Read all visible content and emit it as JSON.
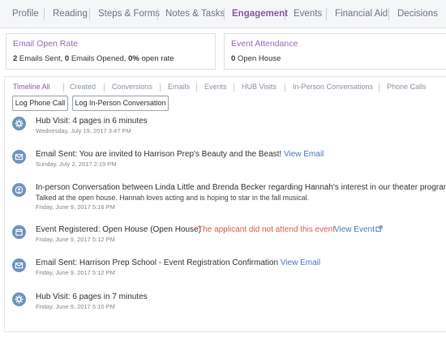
{
  "tabs": [
    {
      "label": "Profile"
    },
    {
      "label": "Reading"
    },
    {
      "label": "Steps & Forms"
    },
    {
      "label": "Notes & Tasks"
    },
    {
      "label": "Engagement"
    },
    {
      "label": "Events"
    },
    {
      "label": "Financial Aid"
    },
    {
      "label": "Decisions"
    }
  ],
  "active_tab": "Engagement",
  "email_card": {
    "title": "Email Open Rate",
    "sent_count": "2",
    "sent_label": " Emails Sent, ",
    "opened_count": "0",
    "opened_label": " Emails Opened, ",
    "rate": "0%",
    "rate_label": " open rate"
  },
  "event_card": {
    "title": "Event Attendance",
    "count": "0",
    "label": " Open House"
  },
  "filters": [
    "Timeline All",
    "Created",
    "Conversions",
    "Emails",
    "Events",
    "HUB Visits",
    "In-Person Conversations",
    "Phone Calls"
  ],
  "buttons": {
    "log_phone": "Log Phone Call",
    "log_inperson": "Log In-Person Conversation"
  },
  "timeline": [
    {
      "icon": "gear-icon",
      "text": "Hub Visit: 4 pages in 6 minutes",
      "date": "Wednesday, July 19, 2017 3:47 PM"
    },
    {
      "icon": "envelope-icon",
      "text": "Email Sent: You are invited to Harrison Prep's Beauty and the Beast!",
      "link": "View Email",
      "date": "Sunday, July 2, 2017 2:19 PM"
    },
    {
      "icon": "person-icon",
      "text": "In-person Conversation between Linda Little and Brenda Becker regarding Hannah's interest in our theater program",
      "note": "Talked at the open house. Hannah loves acting and is hoping to star in the fall musical.",
      "date": "Friday, June 9, 2017 5:16 PM"
    },
    {
      "icon": "calendar-icon",
      "text": "Event Registered: Open House (Open House)",
      "warning": "The applicant did not attend this event",
      "link": "View Event",
      "date": "Friday, June 9, 2017 5:12 PM"
    },
    {
      "icon": "envelope-icon",
      "text": "Email Sent: Harrison Prep School - Event Registration Confirmation",
      "link": "View Email",
      "date": "Friday, June 9, 2017 5:12 PM"
    },
    {
      "icon": "gear-icon",
      "text": "Hub Visit: 6 pages in 7 minutes",
      "date": "Friday, June 9, 2017 5:10 PM"
    }
  ],
  "colors": {
    "accent_purple": "#8a5aa3",
    "link_blue": "#4a7ab8",
    "icon_blue": "#6e93bd",
    "warning_red": "#e05a50"
  }
}
